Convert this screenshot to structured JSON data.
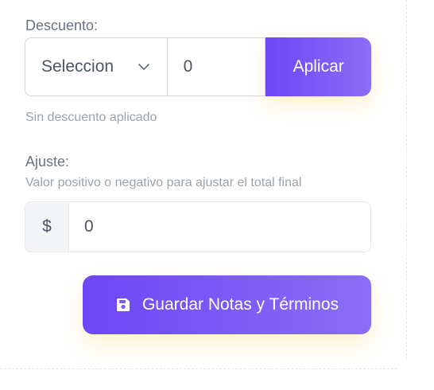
{
  "discount": {
    "label": "Descuento:",
    "select_value": "Seleccion",
    "amount_value": "0",
    "apply_label": "Aplicar",
    "status_text": "Sin descuento aplicado"
  },
  "adjustment": {
    "label": "Ajuste:",
    "help_text": "Valor positivo o negativo para ajustar el total final",
    "currency_symbol": "$",
    "value": "0"
  },
  "save_button": {
    "label": "Guardar Notas y Términos",
    "icon": "save-icon"
  },
  "colors": {
    "accent_start": "#6d46f6",
    "accent_end": "#8a6ef5",
    "text_muted": "#9ca3af",
    "border": "#d1d5db"
  }
}
